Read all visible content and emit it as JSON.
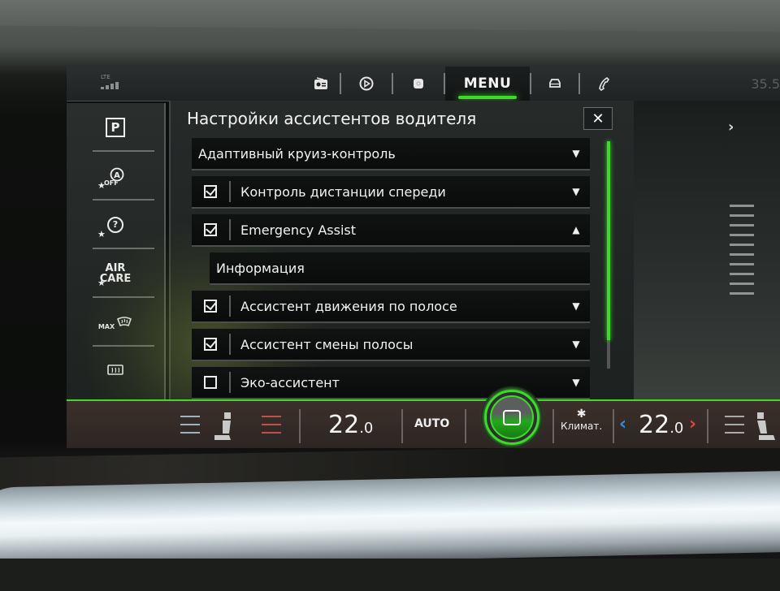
{
  "status_bar": {
    "signal_label": "LTE",
    "outside_temp": "35.5"
  },
  "top_nav": {
    "items": [
      {
        "name": "radio",
        "icon": "radio-icon"
      },
      {
        "name": "media",
        "icon": "play-icon"
      },
      {
        "name": "smartphone",
        "icon": "phone-app-icon"
      },
      {
        "name": "menu",
        "label": "MENU",
        "active": true
      },
      {
        "name": "car",
        "icon": "car-icon"
      },
      {
        "name": "phone",
        "icon": "phone-handset-icon"
      }
    ]
  },
  "left_rail": {
    "items": [
      {
        "name": "parking",
        "label": "P",
        "favorite": false
      },
      {
        "name": "auto-start-stop-off",
        "label": "OFF",
        "favorite": true
      },
      {
        "name": "help",
        "label": "?",
        "favorite": true
      },
      {
        "name": "air-care",
        "label_line1": "AIR",
        "label_line2": "CARE",
        "favorite": true
      },
      {
        "name": "max-defrost",
        "label": "MAX",
        "favorite": false
      },
      {
        "name": "rear-defrost",
        "favorite": false
      }
    ]
  },
  "panel": {
    "title": "Настройки ассистентов водителя",
    "close_label": "✕",
    "items": [
      {
        "label": "Адаптивный круиз-контроль",
        "checkbox": null,
        "expanded": false,
        "indent": false
      },
      {
        "label": "Контроль дистанции спереди",
        "checkbox": true,
        "expanded": false,
        "indent": false
      },
      {
        "label": "Emergency Assist",
        "checkbox": true,
        "expanded": true,
        "indent": false
      },
      {
        "label": "Информация",
        "checkbox": null,
        "expanded": null,
        "indent": true
      },
      {
        "label": "Ассистент движения по полосе",
        "checkbox": true,
        "expanded": false,
        "indent": false
      },
      {
        "label": "Ассистент смены полосы",
        "checkbox": true,
        "expanded": false,
        "indent": false
      },
      {
        "label": "Эко-ассистент",
        "checkbox": false,
        "expanded": false,
        "indent": false
      }
    ],
    "scroll_position_fraction": 0.88
  },
  "climate": {
    "left_temp_main": "22",
    "left_temp_decimal": ".0",
    "auto_label": "AUTO",
    "climate_label": "Климат.",
    "right_temp_main": "22",
    "right_temp_decimal": ".0",
    "accent_color": "#3ed92b",
    "cool_color": "#2f8ef0",
    "heat_color": "#e8433b"
  }
}
